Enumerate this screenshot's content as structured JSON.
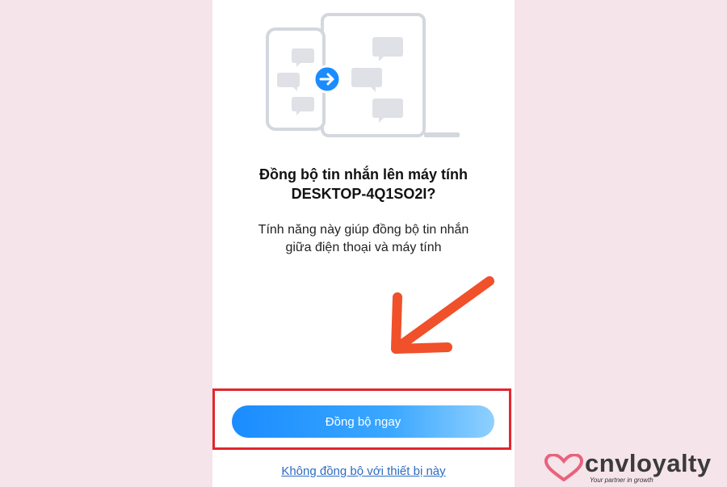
{
  "dialog": {
    "title_line1": "Đồng bộ tin nhắn lên máy tính",
    "title_line2": "DESKTOP-4Q1SO2I?",
    "desc_line1": "Tính năng này giúp đồng bộ tin nhắn",
    "desc_line2": "giữa điện thoại và máy tính",
    "sync_button_label": "Đồng bộ ngay",
    "skip_link_label": "Không đồng bộ với thiết bị này"
  },
  "branding": {
    "logo_text": "cnvloyalty",
    "tagline": "Your partner in growth"
  },
  "colors": {
    "background": "#f5e4e9",
    "button_start": "#1a8cff",
    "button_end": "#8fd0ff",
    "annotation_red": "#e3262e",
    "arrow_orange": "#f0502a",
    "link_blue": "#2e6cc0"
  },
  "icons": [
    "phone-to-laptop-sync-illustration",
    "arrow-right-icon",
    "annotation-arrow",
    "heart-logo-icon"
  ]
}
